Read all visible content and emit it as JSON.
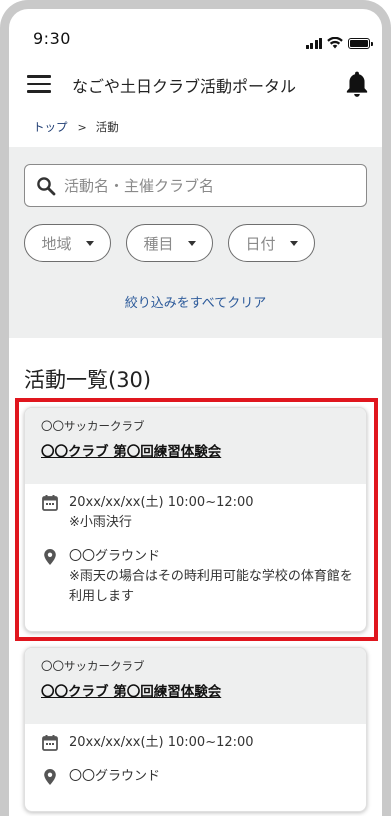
{
  "status_bar": {
    "time": "9:30"
  },
  "header": {
    "title": "なごや土日クラブ活動ポータル"
  },
  "breadcrumb": {
    "home": "トップ",
    "separator": ">",
    "current": "活動"
  },
  "filters": {
    "search_placeholder": "活動名・主催クラブ名",
    "chips": [
      {
        "label": "地域"
      },
      {
        "label": "種目"
      },
      {
        "label": "日付"
      }
    ],
    "clear_label": "絞り込みをすべてクリア"
  },
  "list": {
    "title": "活動一覧(30)",
    "items": [
      {
        "org": "〇〇サッカークラブ",
        "title": "〇〇クラブ 第〇回練習体験会",
        "date": "20xx/xx/xx(土) 10:00~12:00",
        "date_note": "※小雨決行",
        "place": "〇〇グラウンド",
        "place_note": "※雨天の場合はその時利用可能な学校の体育館を利用します"
      },
      {
        "org": "〇〇サッカークラブ",
        "title": "〇〇クラブ 第〇回練習体験会",
        "date": "20xx/xx/xx(土) 10:00~12:00",
        "place": "〇〇グラウンド"
      }
    ]
  },
  "colors": {
    "panel_bg": "#eeefef",
    "link_blue": "#2c5a9a",
    "breadcrumb_link": "#1f3d73",
    "highlight_red": "#e0161e"
  },
  "icons": [
    "menu-icon",
    "bell-icon",
    "search-icon",
    "chevron-down-icon",
    "calendar-icon",
    "location-pin-icon",
    "signal-icon",
    "wifi-icon",
    "battery-icon"
  ]
}
